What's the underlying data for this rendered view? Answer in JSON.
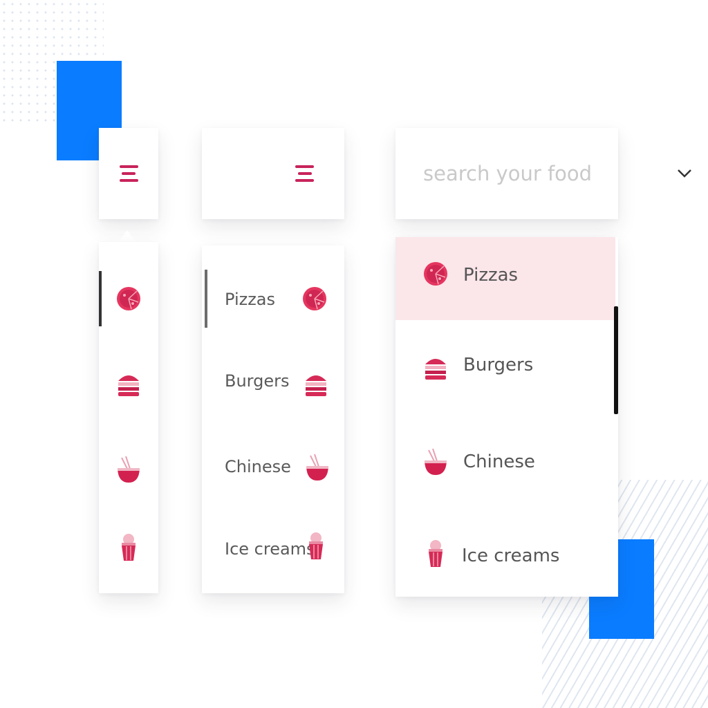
{
  "colors": {
    "accent": "#c8235a",
    "brand_blue": "#0a7cff",
    "selected_bg": "#fbe6ea"
  },
  "panel_compact": {
    "menu_icon": "hamburger-icon",
    "items": [
      {
        "icon": "pizza-icon"
      },
      {
        "icon": "burger-icon"
      },
      {
        "icon": "chinese-bowl-icon"
      },
      {
        "icon": "ice-cream-icon"
      }
    ]
  },
  "panel_expanded": {
    "menu_icon": "hamburger-icon",
    "items": [
      {
        "label": "Pizzas",
        "icon": "pizza-icon"
      },
      {
        "label": "Burgers",
        "icon": "burger-icon"
      },
      {
        "label": "Chinese",
        "icon": "chinese-bowl-icon"
      },
      {
        "label": "Ice creams",
        "icon": "ice-cream-icon"
      }
    ]
  },
  "panel_search": {
    "search_placeholder": "search your food",
    "chevron_icon": "chevron-down-icon",
    "items": [
      {
        "label": "Pizzas",
        "icon": "pizza-icon",
        "selected": true
      },
      {
        "label": "Burgers",
        "icon": "burger-icon"
      },
      {
        "label": "Chinese",
        "icon": "chinese-bowl-icon"
      },
      {
        "label": "Ice creams",
        "icon": "ice-cream-icon"
      }
    ]
  }
}
